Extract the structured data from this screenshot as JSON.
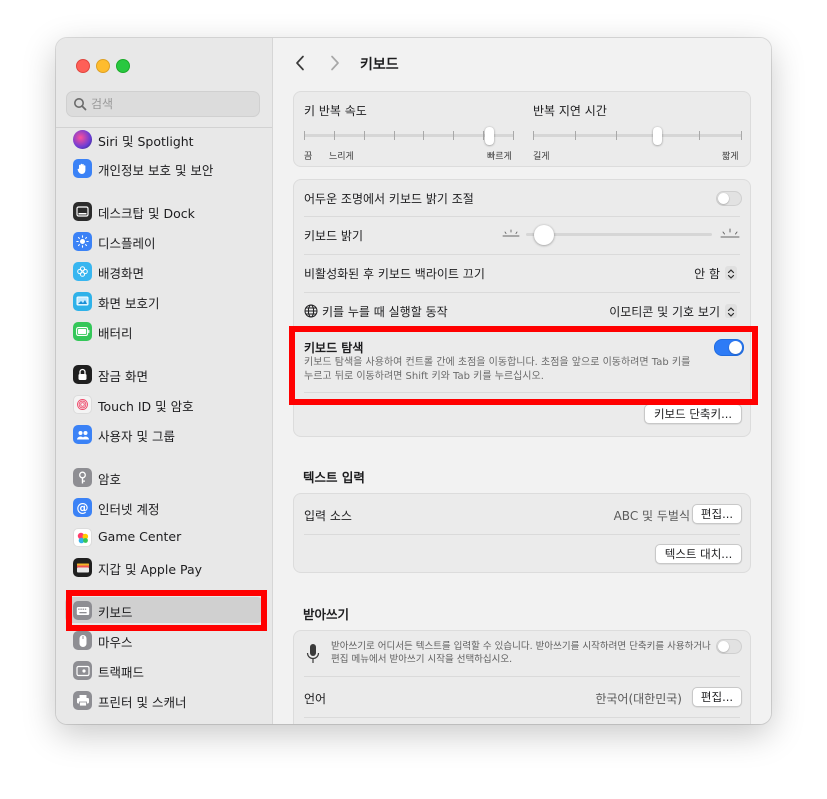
{
  "window": {
    "title": "키보드"
  },
  "sidebar": {
    "search_placeholder": "검색",
    "items": [
      {
        "label": "Siri 및 Spotlight",
        "icon": "siri-icon",
        "color": "#6a3cd6"
      },
      {
        "label": "개인정보 보호 및 보안",
        "icon": "hand-icon",
        "color": "#3b82f6"
      },
      {
        "label": "데스크탑 및 Dock",
        "icon": "dock-icon",
        "color": "#2b2b2b"
      },
      {
        "label": "디스플레이",
        "icon": "sun-icon",
        "color": "#3b82f6"
      },
      {
        "label": "배경화면",
        "icon": "flower-icon",
        "color": "#38b6f0"
      },
      {
        "label": "화면 보호기",
        "icon": "screensaver-icon",
        "color": "#2fb2e9"
      },
      {
        "label": "배터리",
        "icon": "battery-icon",
        "color": "#34c759"
      },
      {
        "label": "잠금 화면",
        "icon": "lock-icon",
        "color": "#1f1f1f"
      },
      {
        "label": "Touch ID 및 암호",
        "icon": "fingerprint-icon",
        "color": "#f4f4f4"
      },
      {
        "label": "사용자 및 그룹",
        "icon": "users-icon",
        "color": "#3b82f6"
      },
      {
        "label": "암호",
        "icon": "key-icon",
        "color": "#8e8e93"
      },
      {
        "label": "인터넷 계정",
        "icon": "at-icon",
        "color": "#3b82f6"
      },
      {
        "label": "Game Center",
        "icon": "gamecenter-icon",
        "color": "#ffffff"
      },
      {
        "label": "지갑 및 Apple Pay",
        "icon": "wallet-icon",
        "color": "#1f1f1f"
      },
      {
        "label": "키보드",
        "icon": "keyboard-icon",
        "color": "#8e8e93",
        "selected": true
      },
      {
        "label": "마우스",
        "icon": "mouse-icon",
        "color": "#8e8e93"
      },
      {
        "label": "트랙패드",
        "icon": "trackpad-icon",
        "color": "#8e8e93"
      },
      {
        "label": "프린터 및 스캐너",
        "icon": "printer-icon",
        "color": "#8e8e93"
      }
    ]
  },
  "repeat": {
    "key_repeat_label": "키 반복 속도",
    "key_repeat_left": "끔",
    "key_repeat_slow": "느리게",
    "key_repeat_fast": "빠르게",
    "key_repeat_value": 0.9,
    "delay_label": "반복 지연 시간",
    "delay_long": "길게",
    "delay_short": "짧게",
    "delay_value": 0.6
  },
  "settings": {
    "dim_light_label": "어두운 조명에서 키보드 밝기 조절",
    "dim_light_on": false,
    "brightness_label": "키보드 밝기",
    "brightness_value": 0.05,
    "backlight_off_label": "비활성화된 후 키보드 백라이트 끄기",
    "backlight_off_value": "안 함",
    "globe_key_label": "키를 누를 때 실행할 동작",
    "globe_key_value": "이모티콘 및 기호 보기",
    "keyboard_nav_label": "키보드 탐색",
    "keyboard_nav_desc_1": "키보드 탐색을 사용하여 컨트롤 간에 초점을 이동합니다. 초점을 앞으로 이동하려면 Tab 키를",
    "keyboard_nav_desc_2": "누르고 뒤로 이동하려면 Shift 키와 Tab 키를 누르십시오.",
    "keyboard_nav_on": true,
    "shortcuts_button": "키보드 단축키..."
  },
  "text_input": {
    "section_title": "텍스트 입력",
    "input_sources_label": "입력 소스",
    "input_sources_value": "ABC 및 두벌식",
    "edit_button": "편집...",
    "text_replace_button": "텍스트 대치..."
  },
  "dictation": {
    "section_title": "받아쓰기",
    "desc_1": "받아쓰기로 어디서든 텍스트를 입력할 수 있습니다. 받아쓰기를 시작하려면 단축키를 사용하거나",
    "desc_2": "편집 메뉴에서 받아쓰기 시작을 선택하십시오.",
    "enabled": false,
    "language_label": "언어",
    "language_value": "한국어(대한민국)",
    "edit_button": "편집..."
  }
}
